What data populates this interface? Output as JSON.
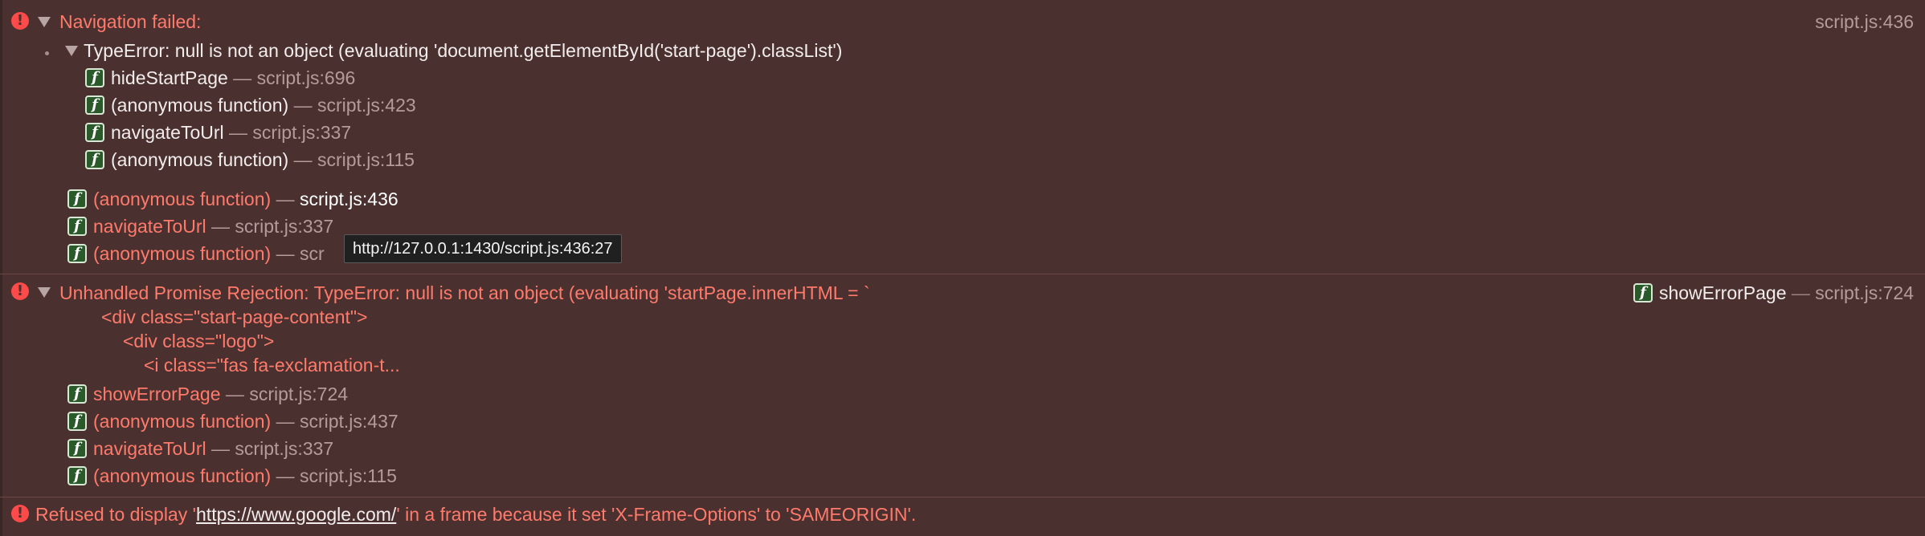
{
  "entries": [
    {
      "message": "Navigation failed:",
      "source": "script.js:436",
      "nested": {
        "message": "TypeError: null is not an object (evaluating 'document.getElementById('start-page').classList')",
        "frames": [
          {
            "fn": "hideStartPage",
            "loc": "script.js:696"
          },
          {
            "fn": "(anonymous function)",
            "loc": "script.js:423"
          },
          {
            "fn": "navigateToUrl",
            "loc": "script.js:337"
          },
          {
            "fn": "(anonymous function)",
            "loc": "script.js:115"
          }
        ]
      },
      "frames": [
        {
          "fn": "(anonymous function)",
          "loc": "script.js:436"
        },
        {
          "fn": "navigateToUrl",
          "loc": "script.js:337"
        },
        {
          "fn": "(anonymous function)",
          "loc": "scr"
        }
      ]
    },
    {
      "message_line1": "Unhandled Promise Rejection: TypeError: null is not an object (evaluating 'startPage.innerHTML = `",
      "code_lines": [
        "<div class=\"start-page-content\">",
        "<div class=\"logo\">",
        "<i class=\"fas fa-exclamation-t..."
      ],
      "source_fn": "showErrorPage",
      "source_loc": "script.js:724",
      "frames": [
        {
          "fn": "showErrorPage",
          "loc": "script.js:724"
        },
        {
          "fn": "(anonymous function)",
          "loc": "script.js:437"
        },
        {
          "fn": "navigateToUrl",
          "loc": "script.js:337"
        },
        {
          "fn": "(anonymous function)",
          "loc": "script.js:115"
        }
      ]
    },
    {
      "prefix": "Refused to display '",
      "url": "https://www.google.com/",
      "suffix": "' in a frame because it set 'X-Frame-Options' to 'SAMEORIGIN'."
    }
  ],
  "tooltip": "http://127.0.0.1:1430/script.js:436:27",
  "separator": "—",
  "function_icon_glyph": "f",
  "colors": {
    "background": "#4a3130",
    "error_text": "#ff7a6b",
    "error_icon": "#ff4a4a",
    "function_icon": "#2a5a2a"
  }
}
